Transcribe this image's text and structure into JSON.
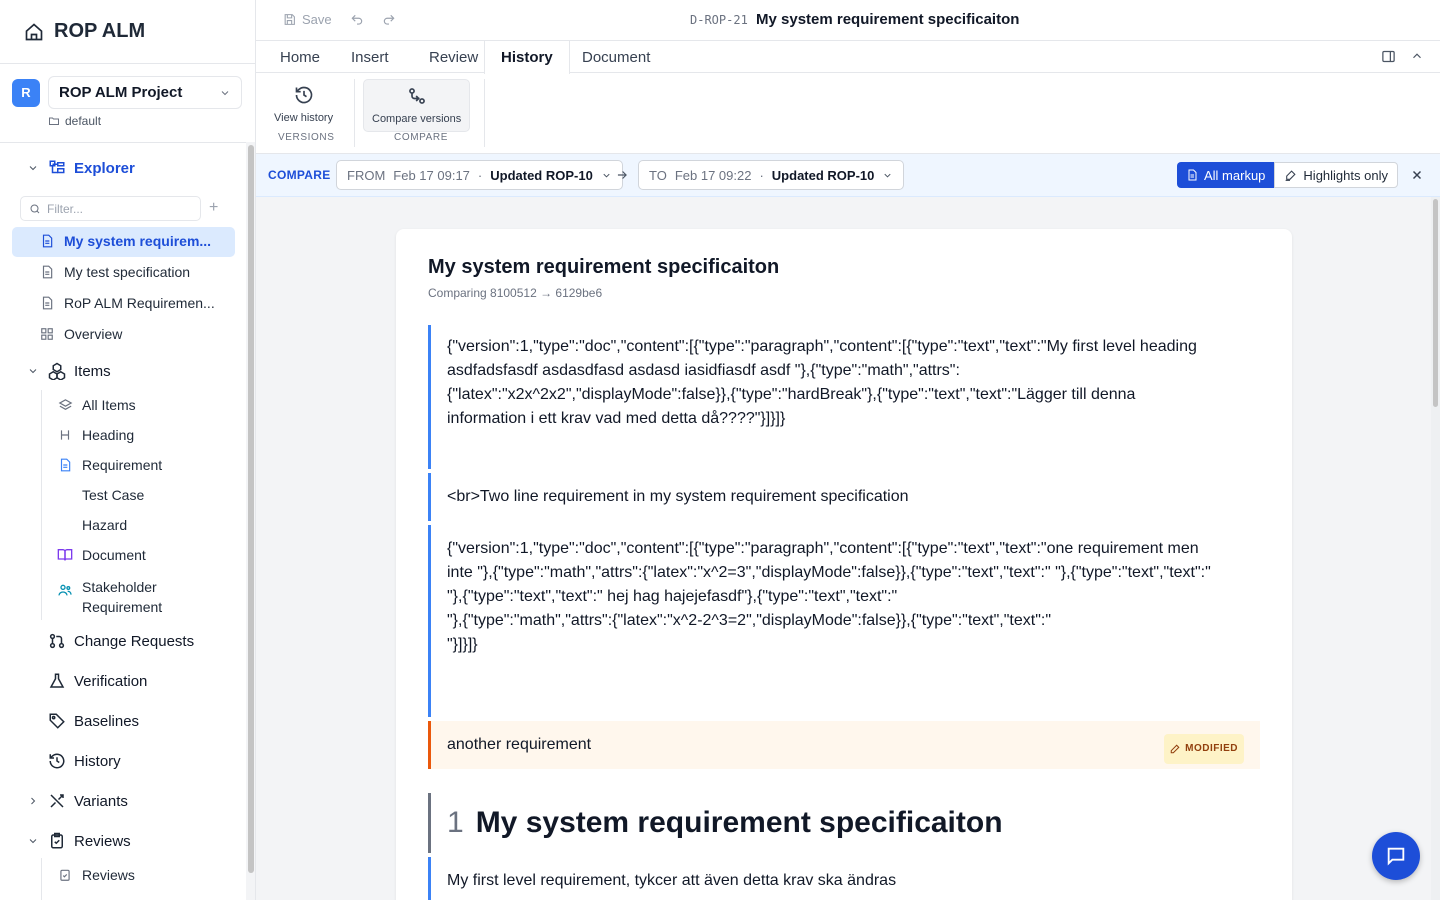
{
  "app": {
    "title": "ROP ALM"
  },
  "project": {
    "initial": "R",
    "name": "ROP ALM Project",
    "workspace": "default"
  },
  "sidebar": {
    "explorer_label": "Explorer",
    "filter_placeholder": "Filter...",
    "documents": [
      "My system requirem...",
      "My test specification",
      "RoP ALM Requiremen...",
      "Overview"
    ],
    "items_label": "Items",
    "item_types": [
      "All Items",
      "Heading",
      "Requirement",
      "Test Case",
      "Hazard",
      "Document",
      "Stakeholder Requirement"
    ],
    "sections": [
      "Change Requests",
      "Verification",
      "Baselines",
      "History",
      "Variants",
      "Reviews"
    ],
    "reviews_child": "Reviews"
  },
  "topbar": {
    "save_label": "Save",
    "doc_id": "D-ROP-21",
    "doc_title": "My system requirement specificaiton"
  },
  "tabs": [
    "Home",
    "Insert",
    "Review",
    "History",
    "Document"
  ],
  "active_tab": "History",
  "ribbon": {
    "view_history": "View history",
    "versions_group": "VERSIONS",
    "compare_versions": "Compare versions",
    "compare_group": "COMPARE"
  },
  "compare": {
    "label": "COMPARE",
    "from_prefix": "FROM",
    "from_date": "Feb 17 09:17",
    "from_change": "Updated ROP-10",
    "to_prefix": "TO",
    "to_date": "Feb 17 09:22",
    "to_change": "Updated ROP-10",
    "all_markup": "All markup",
    "highlights_only": "Highlights only"
  },
  "document": {
    "title": "My system requirement specificaiton",
    "subtitle": "Comparing 8100512 → 6129be6",
    "blocks": [
      "{\"version\":1,\"type\":\"doc\",\"content\":[{\"type\":\"paragraph\",\"content\":[{\"type\":\"text\",\"text\":\"My first level heading asdfadsfasdf asdasdfasd asdasd iasidfiasdf asdf \"},{\"type\":\"math\",\"attrs\":{\"latex\":\"x2x^2x2\",\"displayMode\":false}},{\"type\":\"hardBreak\"},{\"type\":\"text\",\"text\":\"Lägger till denna information i ett krav vad med detta då????\"}]}]}",
      "<br>Two line requirement in my system requirement specification",
      "{\"version\":1,\"type\":\"doc\",\"content\":[{\"type\":\"paragraph\",\"content\":[{\"type\":\"text\",\"text\":\"one requirement men inte \"},{\"type\":\"math\",\"attrs\":{\"latex\":\"x^2=3\",\"displayMode\":false}},{\"type\":\"text\",\"text\":\" \"},{\"type\":\"text\",\"text\":\"",
      "another requirement",
      "My first level requirement, tykcer att även detta krav ska ändras"
    ],
    "json_lines": [
      "{\"type\":\"text\",\"text\":\"",
      "\"},{\"type\":\"text\",\"text\":\" hej hag hajejefasdf\"},{\"type\":\"text\",\"text\":\"",
      "\"},{\"type\":\"math\",\"attrs\":{\"latex\":\"x^2-2^3=2\",\"displayMode\":false}},{\"type\":\"text\",\"text\":\"",
      "\"}]}]}"
    ],
    "modified_badge": "MODIFIED",
    "heading_number": "1",
    "heading_text": "My system requirement specificaiton"
  },
  "colors": {
    "accent": "#1d4ed8",
    "modified": "#ea580c",
    "compare_bg": "#eff6ff"
  }
}
